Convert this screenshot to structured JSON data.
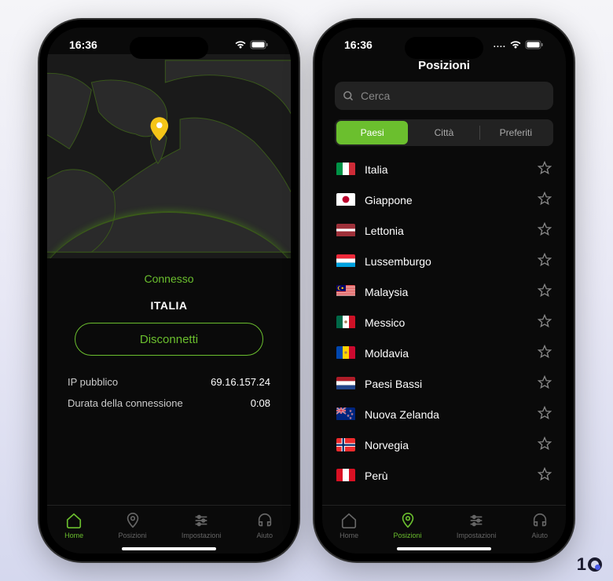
{
  "status_bar": {
    "time": "16:36"
  },
  "home": {
    "status": "Connesso",
    "country": "ITALIA",
    "disconnect_label": "Disconnetti",
    "ip_label": "IP pubblico",
    "ip_value": "69.16.157.24",
    "duration_label": "Durata della connessione",
    "duration_value": "0:08"
  },
  "nav": {
    "home": "Home",
    "locations": "Posizioni",
    "settings": "Impostazioni",
    "help": "Aiuto"
  },
  "locations": {
    "title": "Posizioni",
    "search_placeholder": "Cerca",
    "tabs": {
      "countries": "Paesi",
      "cities": "Città",
      "favorites": "Preferiti"
    },
    "countries": [
      {
        "name": "Italia",
        "flag": "it"
      },
      {
        "name": "Giappone",
        "flag": "jp"
      },
      {
        "name": "Lettonia",
        "flag": "lv"
      },
      {
        "name": "Lussemburgo",
        "flag": "lu"
      },
      {
        "name": "Malaysia",
        "flag": "my"
      },
      {
        "name": "Messico",
        "flag": "mx"
      },
      {
        "name": "Moldavia",
        "flag": "md"
      },
      {
        "name": "Paesi Bassi",
        "flag": "nl"
      },
      {
        "name": "Nuova Zelanda",
        "flag": "nz"
      },
      {
        "name": "Norvegia",
        "flag": "no"
      },
      {
        "name": "Perù",
        "flag": "pe"
      }
    ]
  },
  "brand": "10"
}
